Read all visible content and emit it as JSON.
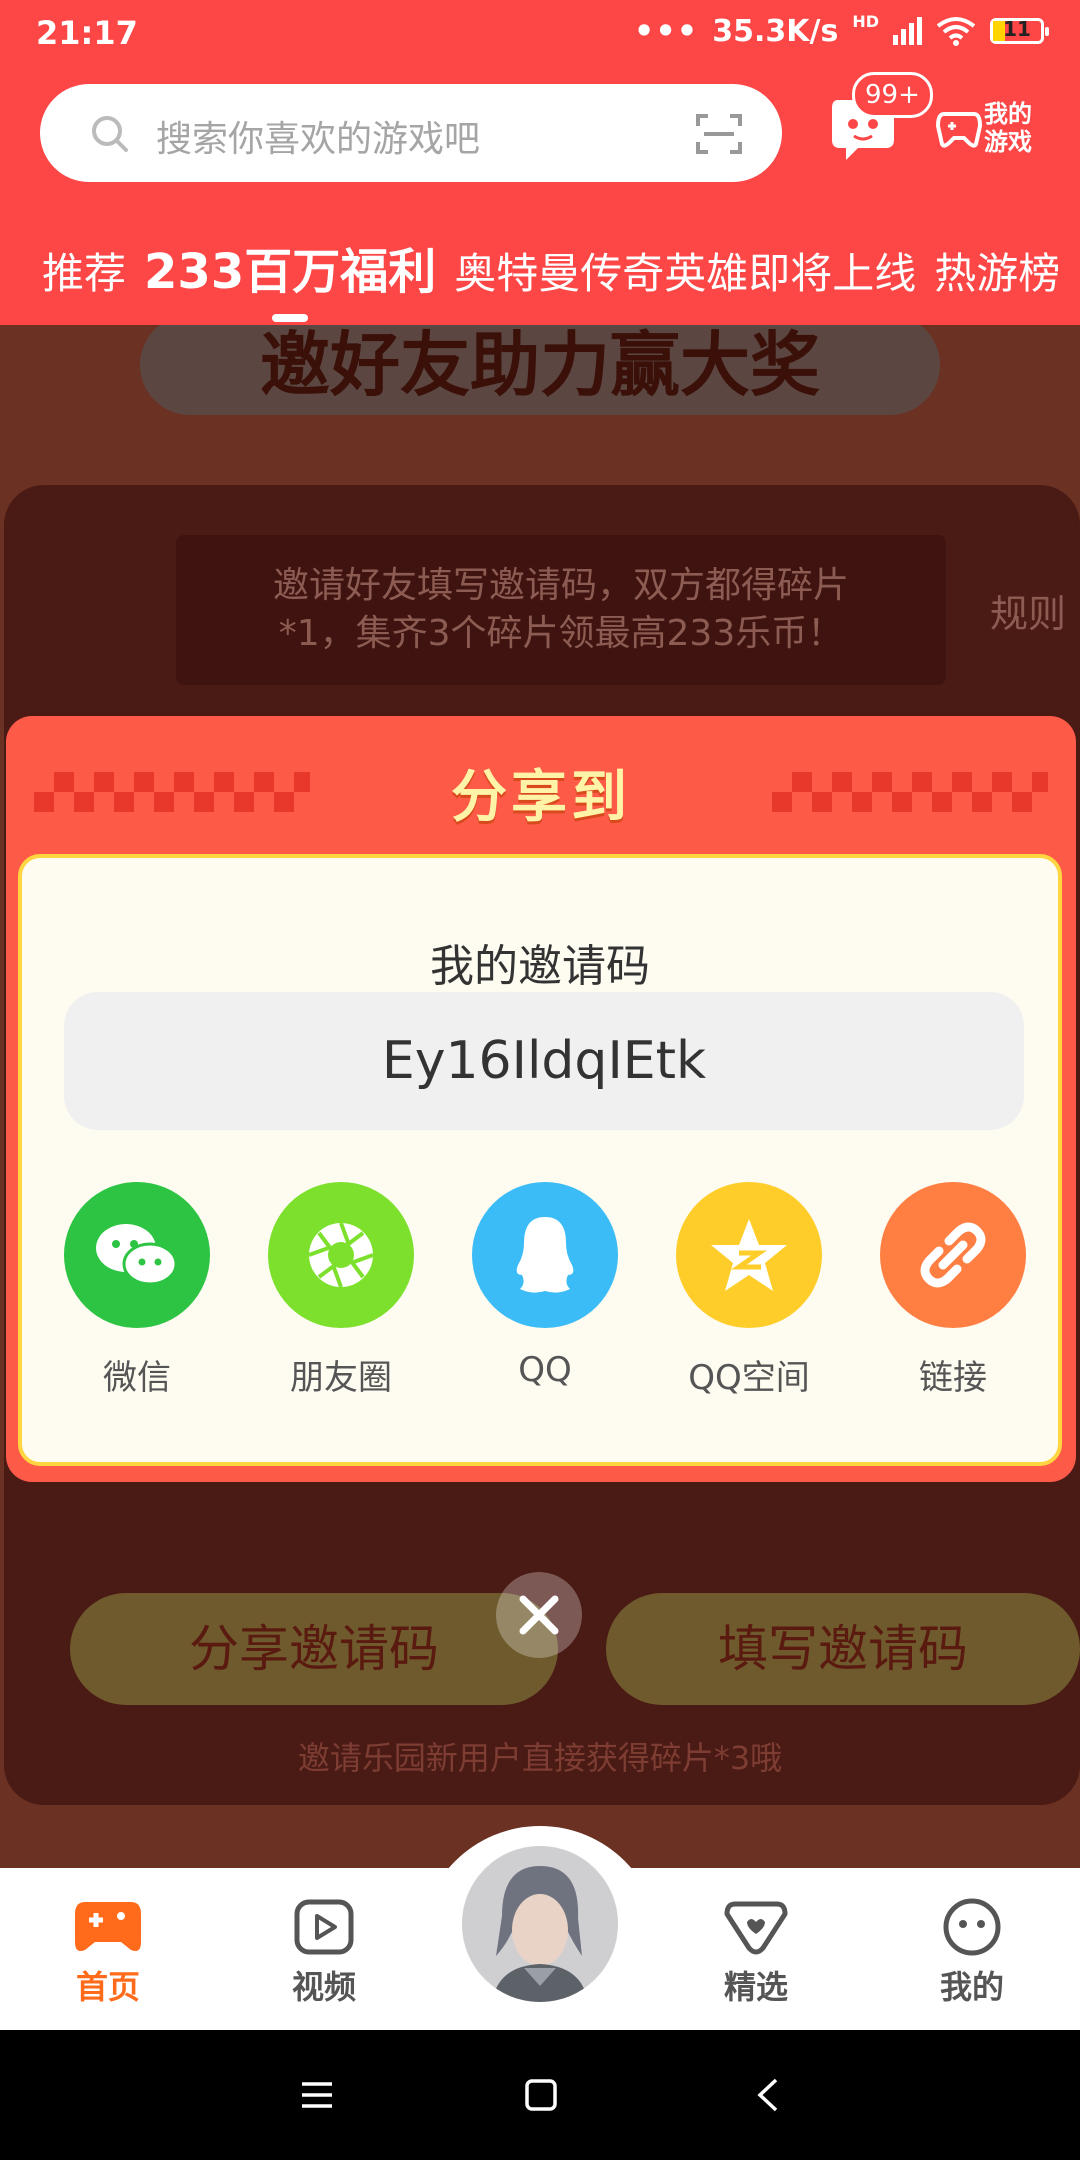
{
  "status_bar": {
    "time": "21:17",
    "dots": "•••",
    "net_speed": "35.3K/s",
    "hd": "HD",
    "battery": "11"
  },
  "header": {
    "search_placeholder": "搜索你喜欢的游戏吧",
    "message_badge": "99+",
    "my_games_line1": "我的",
    "my_games_line2": "游戏",
    "tabs": [
      {
        "label": "推荐",
        "active": false
      },
      {
        "label": "233百万福利",
        "active": true
      },
      {
        "label": "奥特曼传奇英雄即将上线",
        "active": false
      },
      {
        "label": "热游榜",
        "active": false
      }
    ]
  },
  "background": {
    "banner_title": "邀好友助力赢大奖",
    "rule_tip_line1": "邀请好友填写邀请码，双方都得碎片",
    "rule_tip_line2": "*1，集齐3个碎片领最高233乐币！",
    "rules_link": "规则",
    "share_code_button": "分享邀请码",
    "fill_code_button": "填写邀请码",
    "hint": "邀请乐园新用户直接获得碎片*3哦"
  },
  "modal": {
    "title": "分享到",
    "invite_label": "我的邀请码",
    "invite_code": "Ey16IldqIEtk",
    "share_targets": [
      {
        "label": "微信",
        "color": "#2dc443",
        "icon": "wechat-icon"
      },
      {
        "label": "朋友圈",
        "color": "#7ce02c",
        "icon": "moments-icon"
      },
      {
        "label": "QQ",
        "color": "#3bbcf6",
        "icon": "qq-icon"
      },
      {
        "label": "QQ空间",
        "color": "#ffcd2a",
        "icon": "qzone-icon"
      },
      {
        "label": "链接",
        "color": "#ff7f43",
        "icon": "link-icon"
      }
    ]
  },
  "bottom_nav": [
    {
      "label": "首页",
      "active": true
    },
    {
      "label": "视频",
      "active": false
    },
    {
      "label": "精选",
      "active": false
    },
    {
      "label": "我的",
      "active": false
    }
  ],
  "colors": {
    "brand_red": "#fd4646",
    "nav_active": "#ff6b1b",
    "modal_bg": "#fd5a48",
    "modal_border": "#ffd640"
  }
}
